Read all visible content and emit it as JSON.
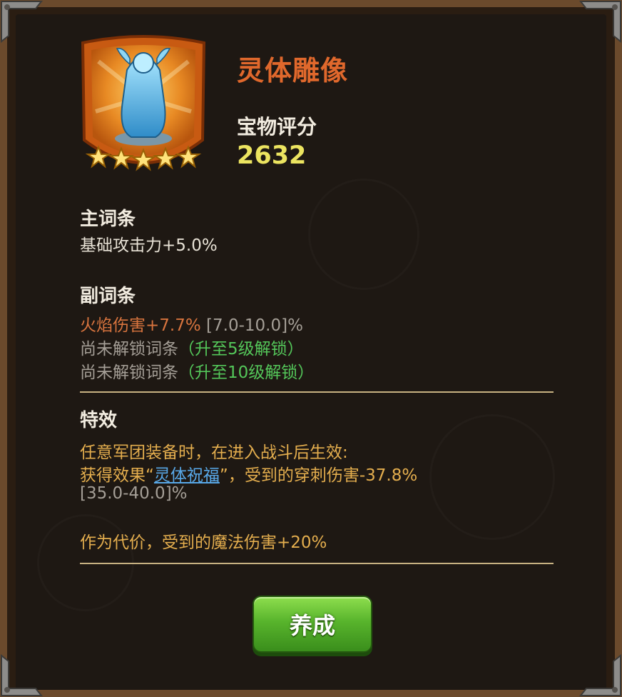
{
  "item": {
    "name": "灵体雕像",
    "stars": 5,
    "score_label": "宝物评分",
    "score_value": "2632"
  },
  "main_affix": {
    "title": "主词条",
    "text": "基础攻击力+5.0%"
  },
  "sub_affix": {
    "title": "副词条",
    "line1_value": "火焰伤害+7.7%",
    "line1_range": "[7.0-10.0]%",
    "line2_locked": "尚未解锁词条",
    "line2_hint": "（升至5级解锁）",
    "line3_locked": "尚未解锁词条",
    "line3_hint": "（升至10级解锁）"
  },
  "effect": {
    "title": "特效",
    "line1": "任意军团装备时，在进入战斗后生效:",
    "line2_pre": "获得效果",
    "line2_quote_open": "“",
    "line2_link": "灵体祝福",
    "line2_quote_close": "”",
    "line2_post": "，受到的穿刺伤害-37.8%",
    "line3_range": "[35.0-40.0]%",
    "line4": "作为代价，受到的魔法伤害+20%"
  },
  "actions": {
    "train_label": "养成"
  },
  "colors": {
    "title_orange": "#e0682c",
    "score_yellow": "#ece460",
    "green_hint": "#54c75a",
    "link_blue": "#58a8e8",
    "button_green": "#58b42c"
  },
  "icons": {
    "badge": "spirit-statue-icon",
    "star": "star-icon"
  }
}
